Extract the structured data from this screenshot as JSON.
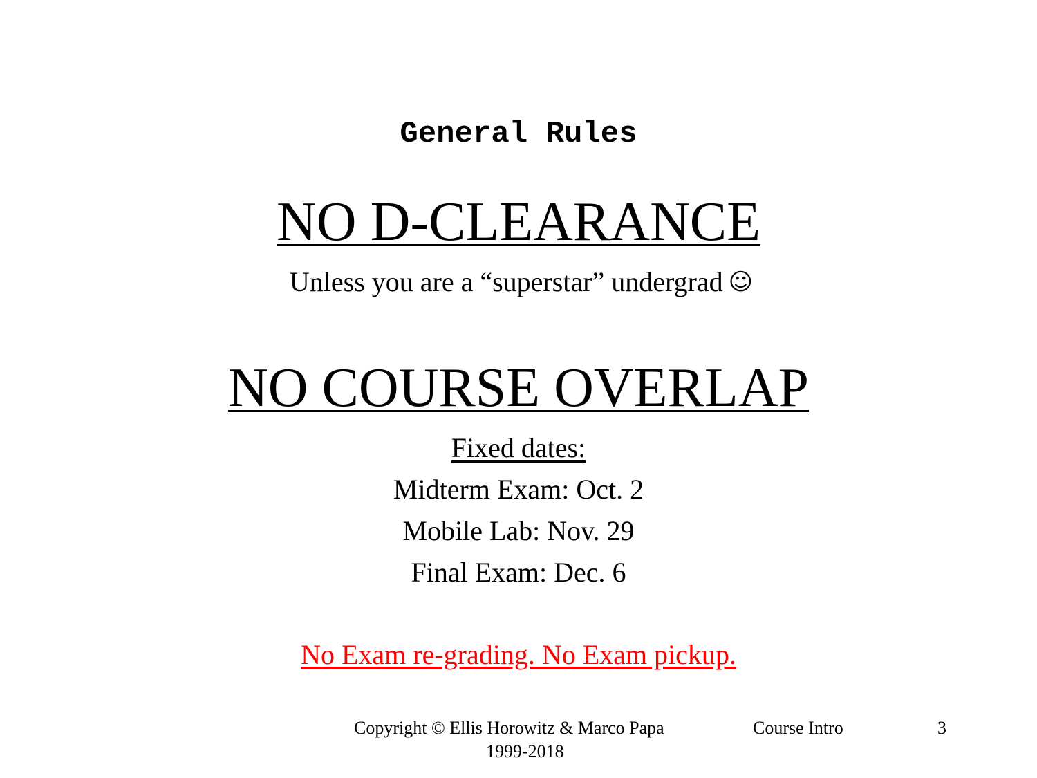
{
  "slide": {
    "title": "General Rules",
    "rule1": "NO D-CLEARANCE",
    "rule1_note": "Unless you are a “superstar” undergrad",
    "rule1_note_emoji": "☺",
    "rule2": "NO COURSE OVERLAP",
    "fixed_dates_label": "Fixed dates:",
    "dates": [
      "Midterm Exam: Oct. 2",
      "Mobile Lab: Nov. 29",
      "Final Exam: Dec. 6"
    ],
    "warning": "No Exam re-grading. No Exam pickup.",
    "warning_color": "#ff0000"
  },
  "footer": {
    "copyright": "Copyright  © Ellis Horowitz  & Marco  Papa",
    "years": "1999-2018",
    "course": "Course  Intro",
    "page_number": "3"
  }
}
